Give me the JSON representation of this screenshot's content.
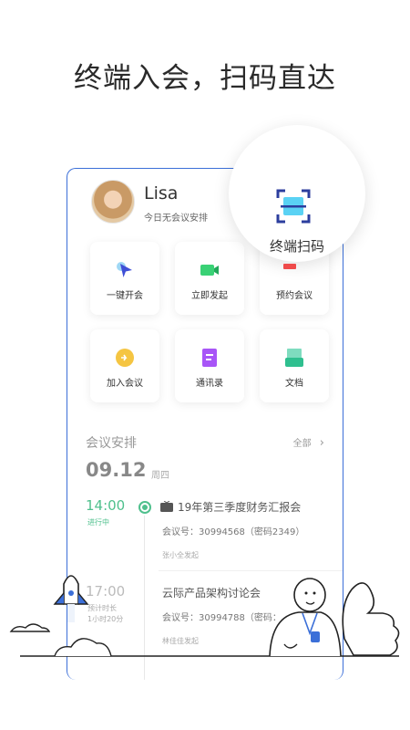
{
  "headline": "终端入会，扫码直达",
  "user": {
    "name": "Lisa",
    "status": "今日无会议安排"
  },
  "scan": {
    "label": "终端扫码"
  },
  "actions": [
    {
      "label": "一键开会",
      "icon": "cursor-arrow-icon"
    },
    {
      "label": "立即发起",
      "icon": "video-camera-icon"
    },
    {
      "label": "预约会议",
      "icon": "calendar-icon"
    },
    {
      "label": "加入会议",
      "icon": "join-bolt-icon"
    },
    {
      "label": "通讯录",
      "icon": "contacts-book-icon"
    },
    {
      "label": "文档",
      "icon": "document-tray-icon"
    }
  ],
  "schedule": {
    "title": "会议安排",
    "view_all": "全部",
    "date": "09.12",
    "weekday": "周四",
    "meetings": [
      {
        "time": "14:00",
        "status": "进行中",
        "title": "19年第三季度财务汇报会",
        "id_text": "会议号：30994568（密码2349）",
        "host": "张小全发起"
      },
      {
        "time": "17:00",
        "duration_label": "预计时长",
        "duration": "1小时20分",
        "title": "云际产品架构讨论会",
        "id_text": "会议号：30994788（密码：",
        "host": "林佳佳发起"
      }
    ]
  },
  "colors": {
    "accent": "#3b6fd8",
    "ongoing": "#4fc08d"
  }
}
